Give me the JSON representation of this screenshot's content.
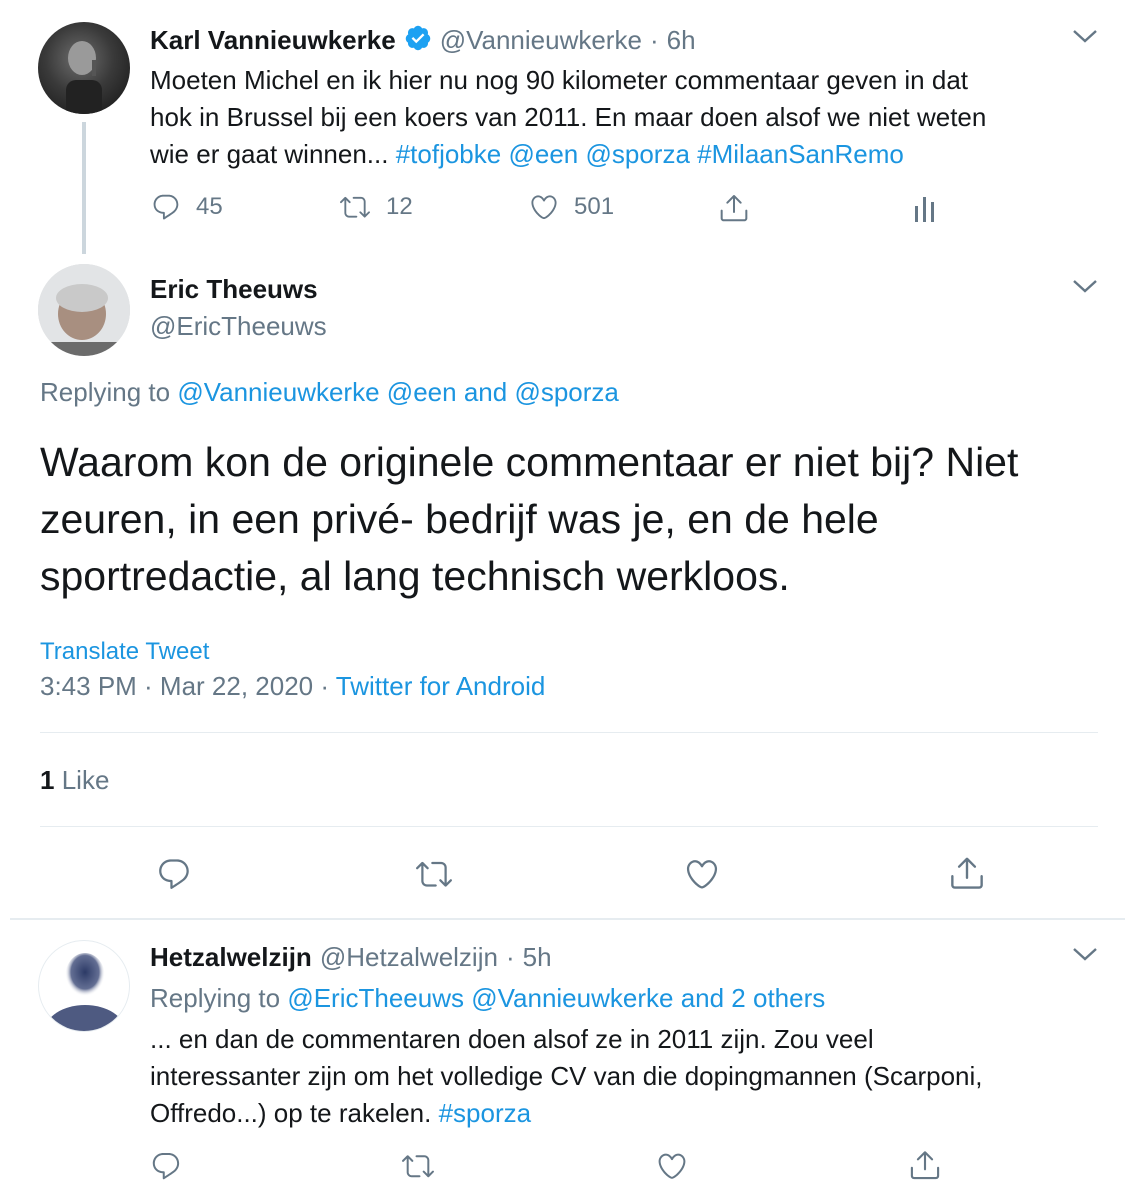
{
  "tweet1": {
    "name": "Karl Vannieuwkerke",
    "handle": "@Vannieuwkerke",
    "sep": "·",
    "time": "6h",
    "text_line1": "Moeten Michel en ik hier nu nog 90 kilometer commentaar geven in dat",
    "text_line2": "hok in Brussel bij een koers van 2011. En maar doen alsof we niet weten",
    "text_line3_plain": "wie er gaat winnen...",
    "tags": [
      "#tofjobke",
      "@een",
      "@sporza",
      "#MilaanSanRemo"
    ],
    "replies": "45",
    "retweets": "12",
    "likes": "501"
  },
  "tweet2": {
    "name": "Eric Theeuws",
    "handle": "@EricTheeuws",
    "replying_prefix": "Replying to",
    "replying_to": [
      "@Vannieuwkerke",
      "@een",
      "and",
      "@sporza"
    ],
    "text_line1": "Waarom kon de originele commentaar er niet bij? Niet",
    "text_line2": "zeuren, in een privé- bedrijf was je, en de hele",
    "text_line3": "sportredactie, al lang technisch werkloos.",
    "translate": "Translate Tweet",
    "timestamp": "3:43 PM · Mar 22, 2020 ·",
    "source": "Twitter for Android",
    "likes_count": "1",
    "likes_label": "Like"
  },
  "tweet3": {
    "name": "Hetzalwelzijn",
    "handle": "@Hetzalwelzijn",
    "sep": "·",
    "time": "5h",
    "replying_prefix": "Replying to",
    "replying_to": [
      "@EricTheeuws",
      "@Vannieuwkerke",
      "and 2 others"
    ],
    "text_line1": "... en dan de commentaren doen alsof ze in 2011 zijn. Zou veel",
    "text_line2": "interessanter zijn om het volledige CV van die dopingmannen (Scarponi,",
    "text_line3_plain": "Offredo...) op te rakelen.",
    "tag": "#sporza"
  },
  "icons": {
    "reply": "reply-icon",
    "retweet": "retweet-icon",
    "like": "heart-icon",
    "share": "share-icon",
    "analytics": "analytics-icon",
    "verified": "verified-badge-icon",
    "more": "chevron-down-icon"
  },
  "colors": {
    "link": "#1b95e0",
    "secondary": "#657786",
    "text": "#14171a",
    "divider": "#e6ecf0"
  }
}
